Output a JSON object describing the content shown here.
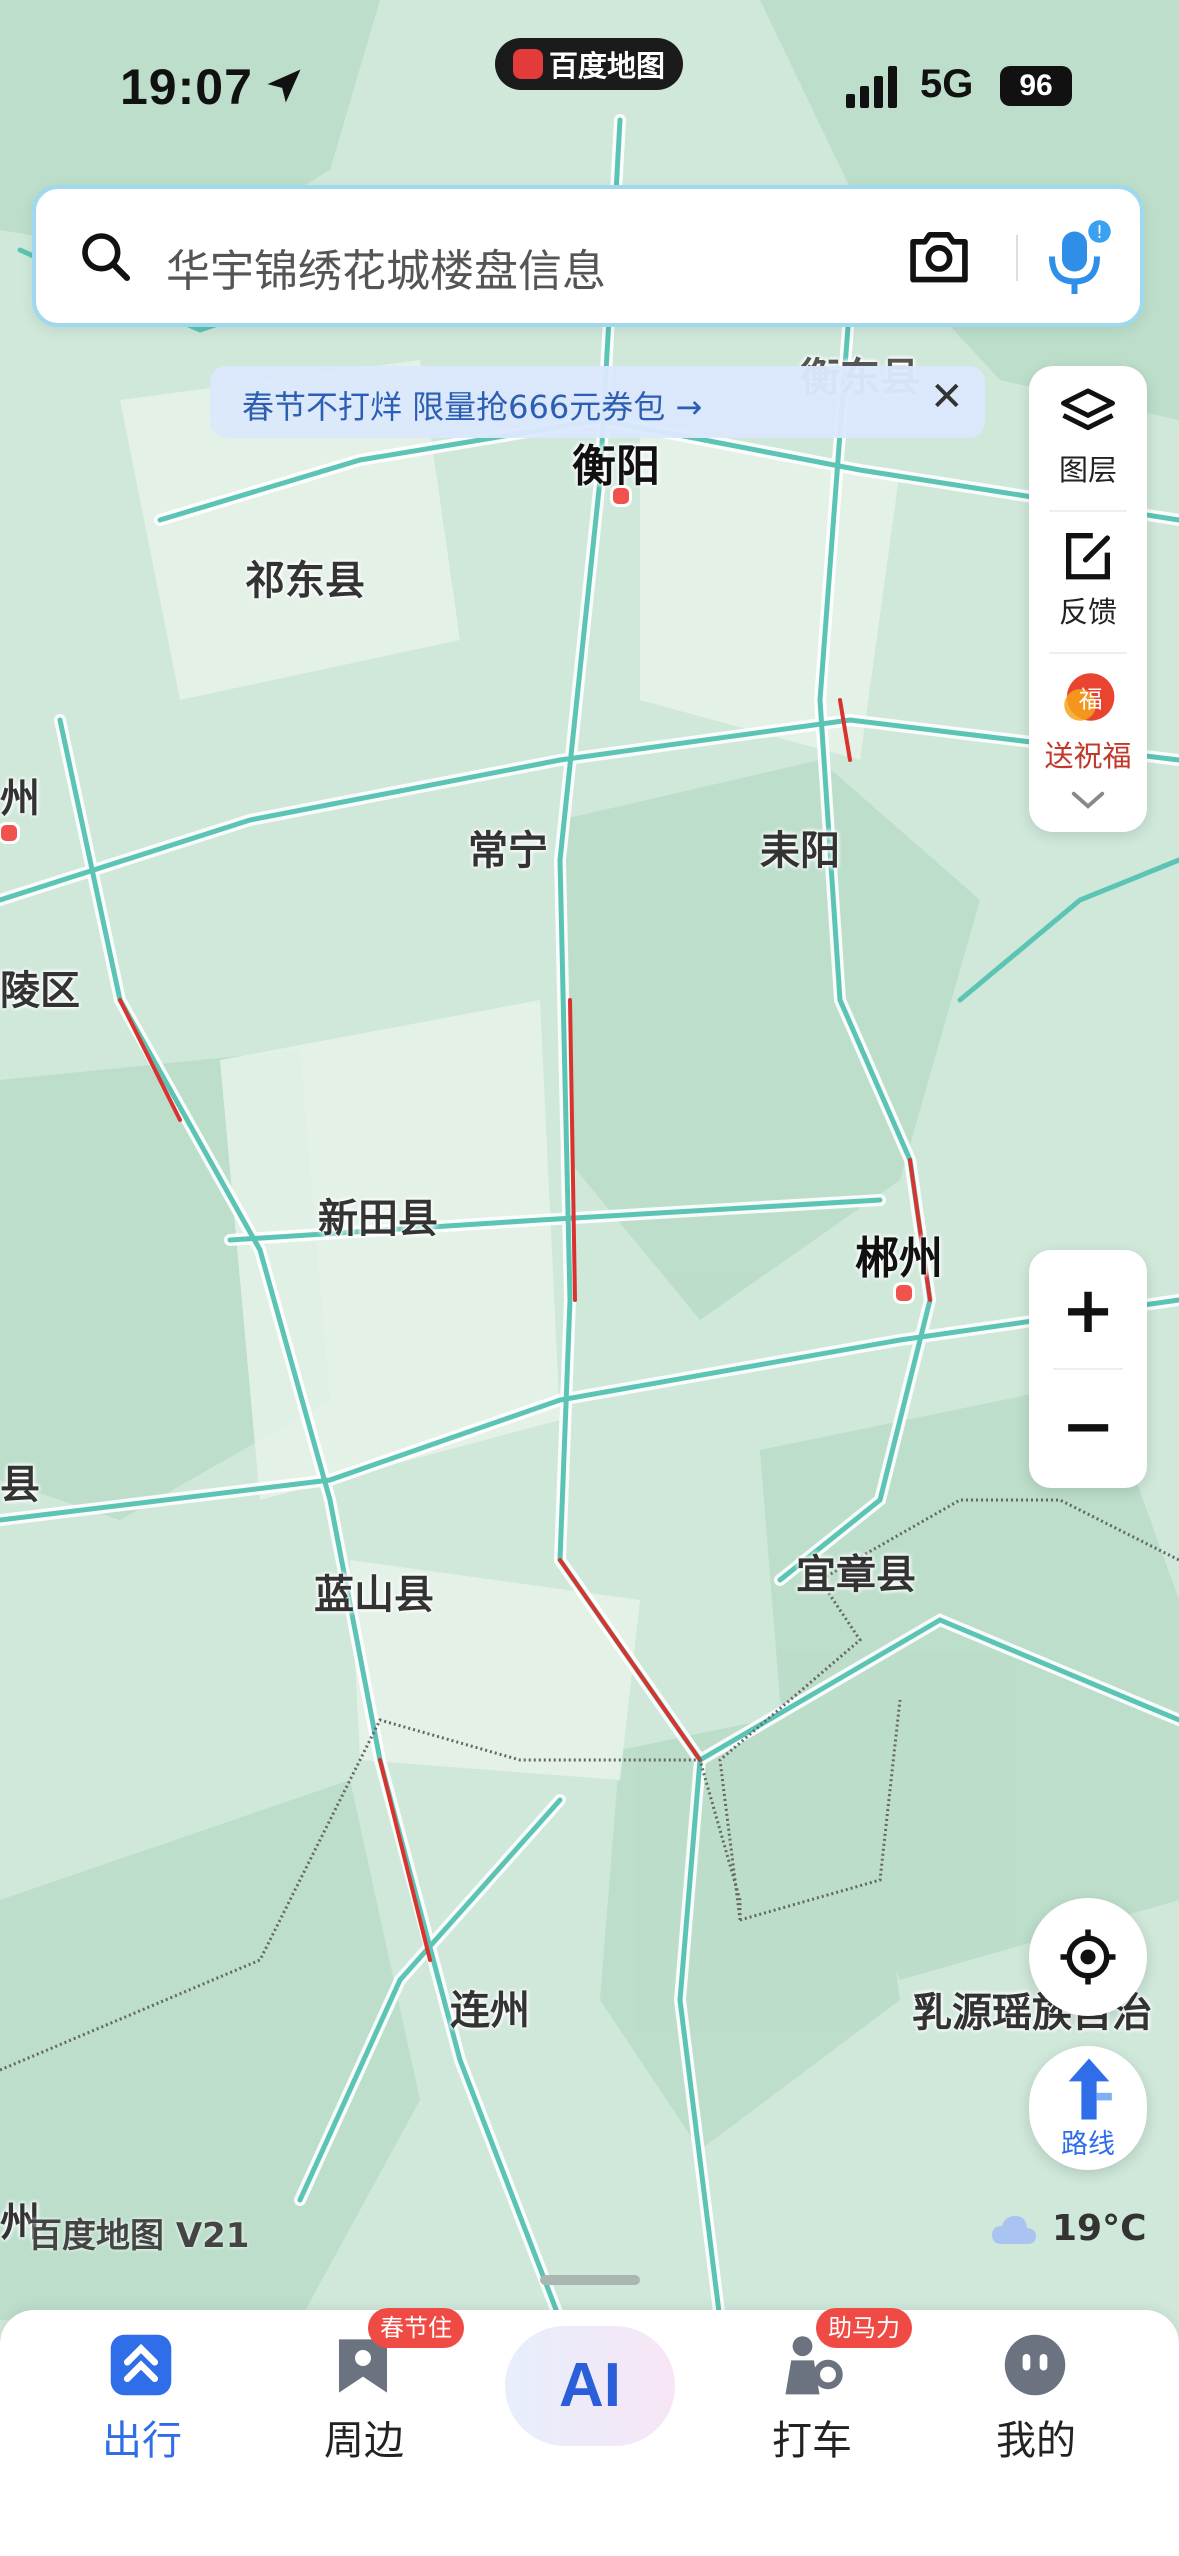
{
  "status_bar": {
    "time": "19:07",
    "app_pill": "百度地图",
    "network": "5G",
    "battery": "96"
  },
  "search": {
    "placeholder": "华宇锦绣花城楼盘信息"
  },
  "promo": {
    "text": "春节不打烊 限量抢666元券包 →",
    "close": "✕"
  },
  "side_panel": {
    "layers_label": "图层",
    "feedback_label": "反馈",
    "blessing_label": "送祝福"
  },
  "zoom": {
    "in": "+",
    "out": "−"
  },
  "route": {
    "label": "路线"
  },
  "map": {
    "labels": {
      "hengdong": "衡东县",
      "hengyang": "衡阳",
      "qidong": "祁东县",
      "zhou_left": "州",
      "changning": "常宁",
      "leiyang": "耒阳",
      "ling_qu": "陵区",
      "xintian": "新田县",
      "chenzhou": "郴州",
      "xian_left": "县",
      "lanshan": "蓝山县",
      "yizhang": "宜章县",
      "lianzhou": "连州",
      "ruyuan": "乳源瑶族自治",
      "bottom_left": "州"
    },
    "watermark": "百度地图 V21",
    "weather": "19°C"
  },
  "tabbar": {
    "tabs": [
      {
        "label": "出行"
      },
      {
        "label": "周边",
        "badge": "春节住"
      },
      {
        "label": "AI"
      },
      {
        "label": "打车",
        "badge": "助马力"
      },
      {
        "label": "我的"
      }
    ]
  },
  "colors": {
    "accent": "#2f6ee8",
    "map_bg": "#cfe8da",
    "road": "#5cc4b4",
    "traffic_red": "#d8332f",
    "badge_red": "#f04a44"
  }
}
